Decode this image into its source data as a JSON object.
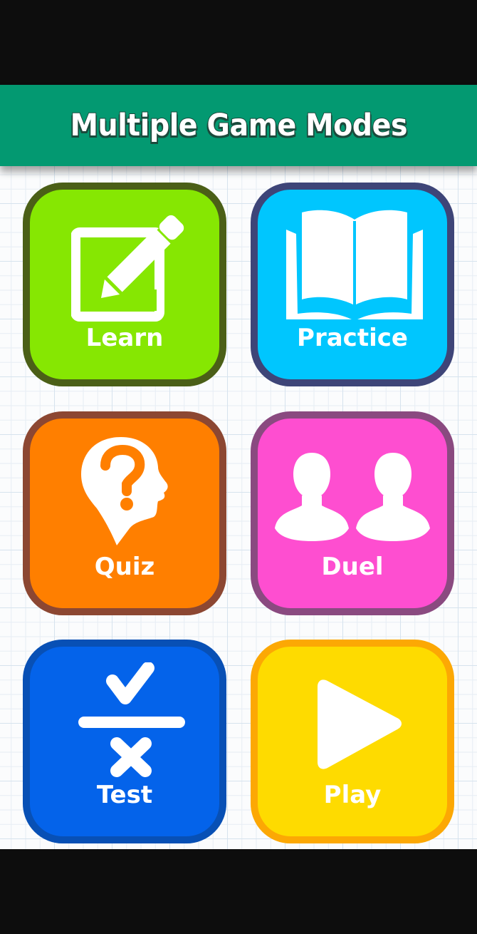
{
  "header": {
    "title": "Multiple Game Modes"
  },
  "modes": [
    {
      "id": "learn",
      "label": "Learn",
      "icon": "edit-pencil-icon",
      "color": "#86e702",
      "border": "#4b5f17"
    },
    {
      "id": "practice",
      "label": "Practice",
      "icon": "open-book-icon",
      "color": "#00c6fe",
      "border": "#3e4578"
    },
    {
      "id": "quiz",
      "label": "Quiz",
      "icon": "head-question-icon",
      "color": "#ff7f00",
      "border": "#8c4732"
    },
    {
      "id": "duel",
      "label": "Duel",
      "icon": "two-users-icon",
      "color": "#fe4ed0",
      "border": "#8a4a80"
    },
    {
      "id": "test",
      "label": "Test",
      "icon": "check-cross-icon",
      "color": "#0463ea",
      "border": "#0850b5"
    },
    {
      "id": "play",
      "label": "Play",
      "icon": "play-icon",
      "color": "#fedb00",
      "border": "#fca804"
    }
  ],
  "theme": {
    "banner_color": "#039971",
    "background": "#fbfcfd"
  }
}
